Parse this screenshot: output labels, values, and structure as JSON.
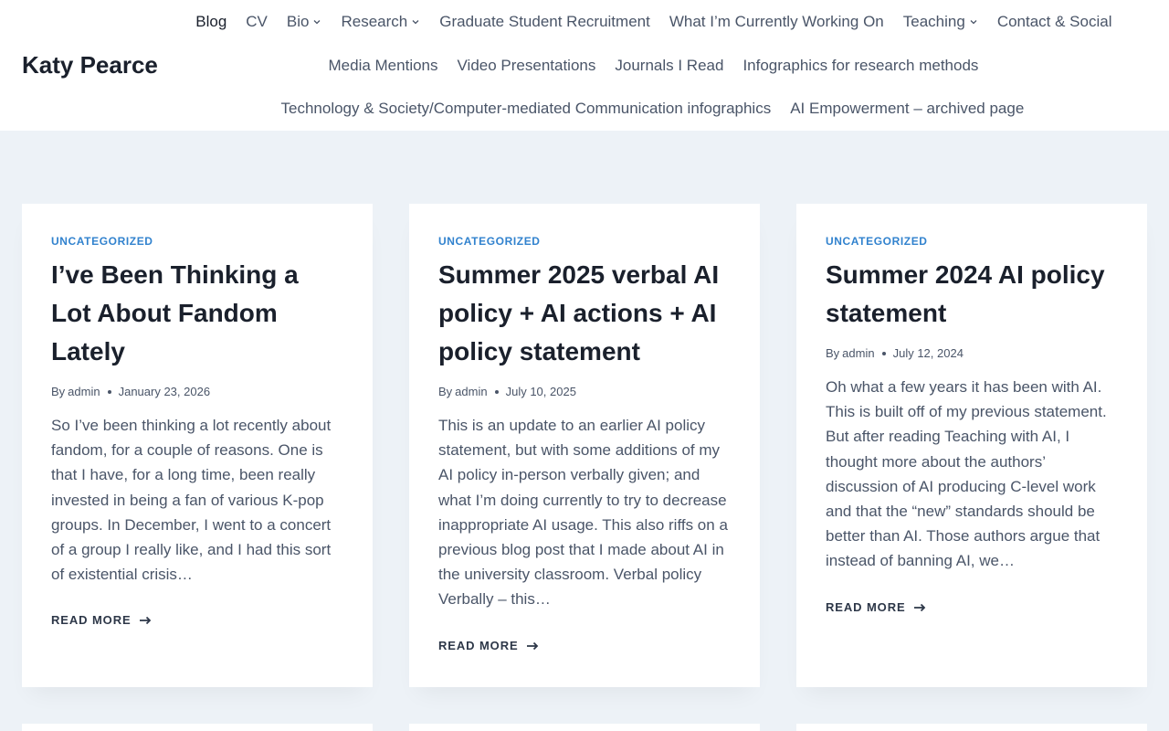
{
  "site": {
    "title": "Katy Pearce"
  },
  "nav": {
    "row1": [
      {
        "label": "Blog",
        "dropdown": false,
        "active": true
      },
      {
        "label": "CV",
        "dropdown": false
      },
      {
        "label": "Bio",
        "dropdown": true
      },
      {
        "label": "Research",
        "dropdown": true
      },
      {
        "label": "Graduate Student Recruitment",
        "dropdown": false
      },
      {
        "label": "What I’m Currently Working On",
        "dropdown": false
      },
      {
        "label": "Teaching",
        "dropdown": true
      },
      {
        "label": "Contact & Social",
        "dropdown": false
      }
    ],
    "row2": [
      {
        "label": "Media Mentions"
      },
      {
        "label": "Video Presentations"
      },
      {
        "label": "Journals I Read"
      },
      {
        "label": "Infographics for research methods"
      }
    ],
    "row3": [
      {
        "label": "Technology & Society/Computer-mediated Communication infographics"
      },
      {
        "label": "AI Empowerment – archived page"
      }
    ]
  },
  "posts": [
    {
      "category": "Uncategorized",
      "title": "I’ve Been Thinking a Lot About Fandom Lately",
      "by": "By",
      "author": "admin",
      "date": "January 23, 2026",
      "excerpt": "So I’ve been thinking a lot recently about fandom, for a couple of reasons. One is that I have, for a long time, been really invested in being a fan of various K-pop groups. In December, I went to a concert of a group I really like, and I had this sort of existential crisis…",
      "read_more": "Read More"
    },
    {
      "category": "Uncategorized",
      "title": "Summer 2025 verbal AI policy + AI actions + AI policy statement",
      "by": "By",
      "author": "admin",
      "date": "July 10, 2025",
      "excerpt": "This is an update to an earlier AI policy statement, but with some additions of my AI policy in-person verbally given; and what I’m doing currently to try to decrease inappropriate AI usage. This also riffs on a previous blog post that I made about AI in the university classroom. Verbal policy Verbally – this…",
      "read_more": "Read More"
    },
    {
      "category": "Uncategorized",
      "title": "Summer 2024 AI policy statement",
      "by": "By",
      "author": "admin",
      "date": "July 12, 2024",
      "excerpt": "Oh what a few years it has been with AI. This is built off of my previous statement. But after reading Teaching with AI, I thought more about the authors’ discussion of AI producing C-level work and that the “new” standards should be better than AI. Those authors argue that instead of banning AI, we…",
      "read_more": "Read More"
    }
  ],
  "colors": {
    "background": "#edf2f7",
    "card": "#ffffff",
    "category": "#3182ce",
    "heading": "#1a202c",
    "body_text": "#4a5568"
  },
  "icons": {
    "dropdown": "chevron-down-icon",
    "read_more": "arrow-right-icon"
  }
}
